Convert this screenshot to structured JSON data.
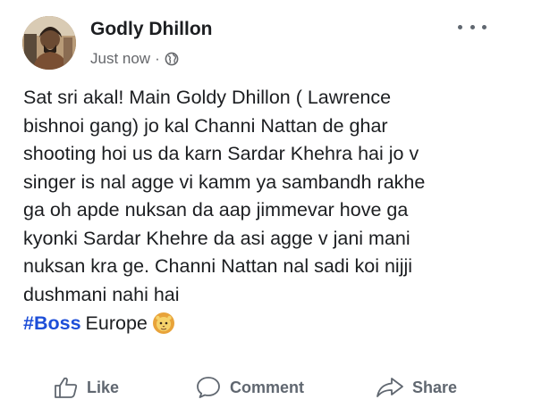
{
  "post": {
    "author": "Godly Dhillon",
    "timestamp": "Just now",
    "separator": "·",
    "privacy_icon": "globe-icon",
    "more_icon": "more-options-icon",
    "body_lines": [
      "Sat sri akal! Main Goldy Dhillon ( Lawrence",
      "bishnoi gang) jo kal Channi Nattan de ghar",
      "shooting hoi us da karn Sardar Khehra hai jo v",
      "singer is nal agge vi kamm ya sambandh rakhe",
      "ga oh apde nuksan da aap jimmevar hove ga",
      "kyonki Sardar Khehre da asi agge v jani mani",
      "nuksan kra ge. Channi Nattan nal sadi koi nijji",
      "dushmani nahi hai"
    ],
    "hashtag": "#Boss",
    "location": "Europe",
    "emoji_icon": "lion-face-icon"
  },
  "actions": {
    "like": "Like",
    "comment": "Comment",
    "share": "Share"
  },
  "colors": {
    "text": "#1c1e21",
    "secondary": "#65676b",
    "hashtag": "#1d4ed8",
    "action": "#606770"
  }
}
